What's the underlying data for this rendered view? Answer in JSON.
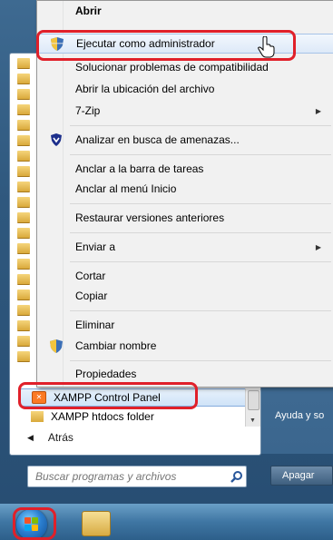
{
  "context_menu": {
    "items": [
      {
        "label": "Abrir",
        "bold": true
      },
      {
        "label": "Ejecutar como administrador",
        "icon": "uac-shield-icon"
      },
      {
        "label": "Solucionar problemas de compatibilidad"
      },
      {
        "label": "Abrir la ubicación del archivo"
      },
      {
        "label": "7-Zip",
        "submenu": true
      },
      {
        "label": "Analizar en busca de amenazas...",
        "icon": "antivirus-shield-icon"
      },
      {
        "label": "Anclar a la barra de tareas"
      },
      {
        "label": "Anclar al menú Inicio"
      },
      {
        "label": "Restaurar versiones anteriores"
      },
      {
        "label": "Enviar a",
        "submenu": true
      },
      {
        "label": "Cortar"
      },
      {
        "label": "Copiar"
      },
      {
        "label": "Eliminar"
      },
      {
        "label": "Cambiar nombre",
        "icon": "uac-shield-icon"
      },
      {
        "label": "Propiedades"
      }
    ]
  },
  "programs": [
    {
      "label": "XAMPP Control Panel",
      "icon": "xampp-icon",
      "selected": true
    },
    {
      "label": "XAMPP htdocs folder",
      "icon": "folder-icon"
    }
  ],
  "back_label": "Atrás",
  "search": {
    "placeholder": "Buscar programas y archivos"
  },
  "right_pane": {
    "help_label": "Ayuda y so"
  },
  "shutdown_label": "Apagar",
  "colors": {
    "annotation": "#e0202a",
    "taskbar": "#3f76a3"
  }
}
